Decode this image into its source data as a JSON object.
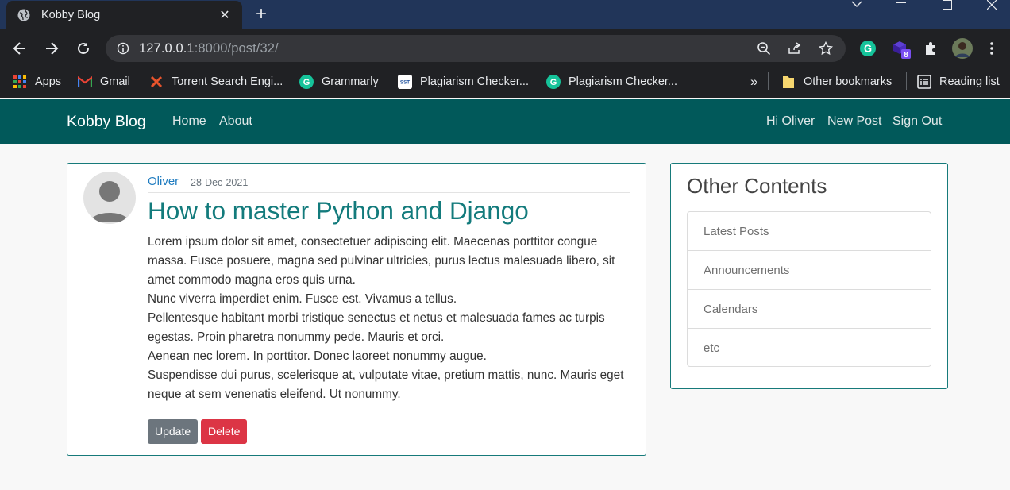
{
  "browser": {
    "tab_title": "Kobby Blog",
    "url_host": "127.0.0.1",
    "url_path": ":8000/post/32/",
    "extension_badge": "8",
    "bookmarks": [
      {
        "label": "Apps",
        "icon": "apps-grid-icon"
      },
      {
        "label": "Gmail",
        "icon": "gmail-icon"
      },
      {
        "label": "Torrent Search Engi...",
        "icon": "torrent-icon"
      },
      {
        "label": "Grammarly",
        "icon": "grammarly-icon"
      },
      {
        "label": "Plagiarism Checker...",
        "icon": "sst-icon"
      },
      {
        "label": "Plagiarism Checker...",
        "icon": "grammarly-icon"
      }
    ],
    "overflow": "»",
    "other_bookmarks": "Other bookmarks",
    "reading_list": "Reading list"
  },
  "site": {
    "brand": "Kobby Blog",
    "nav_left": [
      "Home",
      "About"
    ],
    "nav_right": [
      "Hi Oliver",
      "New Post",
      "Sign Out"
    ]
  },
  "post": {
    "author": "Oliver",
    "date": "28-Dec-2021",
    "title": "How to master Python and Django",
    "paragraphs": [
      "Lorem ipsum dolor sit amet, consectetuer adipiscing elit. Maecenas porttitor congue massa. Fusce posuere, magna sed pulvinar ultricies, purus lectus malesuada libero, sit amet commodo magna eros quis urna.",
      "Nunc viverra imperdiet enim. Fusce est. Vivamus a tellus.",
      "Pellentesque habitant morbi tristique senectus et netus et malesuada fames ac turpis egestas. Proin pharetra nonummy pede. Mauris et orci.",
      "Aenean nec lorem. In porttitor. Donec laoreet nonummy augue.",
      "Suspendisse dui purus, scelerisque at, vulputate vitae, pretium mattis, nunc. Mauris eget neque at sem venenatis eleifend. Ut nonummy."
    ],
    "update_label": "Update",
    "delete_label": "Delete"
  },
  "sidebar": {
    "title": "Other Contents",
    "items": [
      "Latest Posts",
      "Announcements",
      "Calendars",
      "etc"
    ]
  },
  "colors": {
    "navbar": "#01595a",
    "title": "#137b7c",
    "author_link": "#1f7cc0",
    "update_button": "#6c757d",
    "delete_button": "#dc3545"
  }
}
